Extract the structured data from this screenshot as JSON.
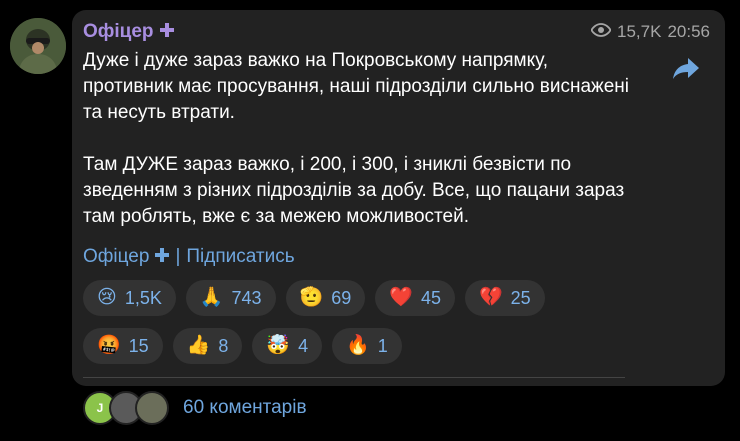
{
  "post": {
    "author_name": "Офіцер",
    "author_badge_icon": "plus-icon",
    "views": "15,7K",
    "time": "20:56",
    "paragraphs": [
      "Дуже і дуже зараз важко на Покровському напрямку, противник має просування, наші підрозділи сильно виснажені та несуть втрати.",
      "Там ДУЖЕ зараз важко, і 200, і 300, і зниклі безвісти по зведенням з різних підрозділів за добу. Все, що пацани зараз там роблять, вже є за межею можливостей."
    ],
    "signature_name": "Офіцер",
    "signature_separator": "|",
    "subscribe_label": "Підписатись"
  },
  "reactions": [
    {
      "emoji": "😢",
      "count": "1,5K"
    },
    {
      "emoji": "🙏",
      "count": "743"
    },
    {
      "emoji": "🫡",
      "count": "69"
    },
    {
      "emoji": "❤️",
      "count": "45"
    },
    {
      "emoji": "💔",
      "count": "25"
    },
    {
      "emoji": "🤬",
      "count": "15"
    },
    {
      "emoji": "👍",
      "count": "8"
    },
    {
      "emoji": "🤯",
      "count": "4"
    },
    {
      "emoji": "🔥",
      "count": "1"
    }
  ],
  "comments": {
    "avatars": [
      {
        "initial": "J",
        "color": "#8bc34a"
      },
      {
        "initial": "",
        "color": "#5a5a5a"
      },
      {
        "initial": "",
        "color": "#6b6e5a"
      }
    ],
    "label": "60 коментарів"
  },
  "colors": {
    "accent": "#6fa6de",
    "author": "#a88ee0",
    "bubble": "#222222"
  }
}
